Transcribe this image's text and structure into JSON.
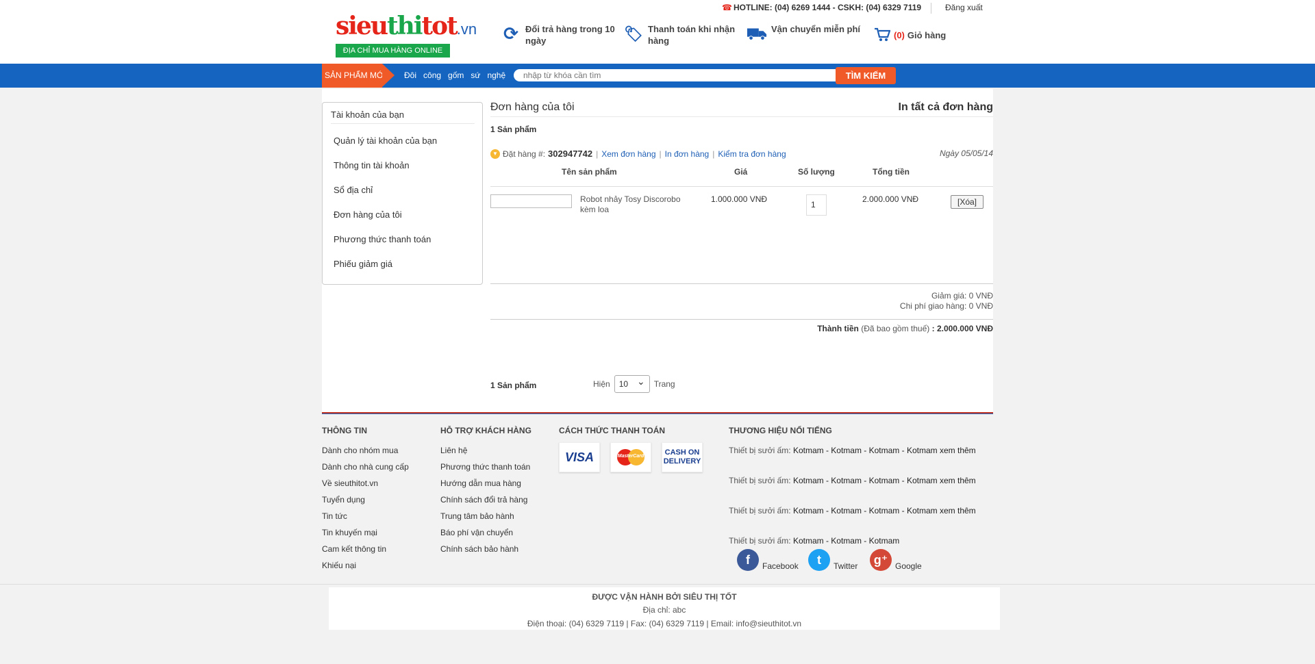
{
  "header": {
    "logo_main": "sieuthitot",
    "logo_part1": "sieu",
    "logo_part2": "thi",
    "logo_part3": "tot",
    "logo_domain": ".vn",
    "logo_tagline": "ĐỊA CHỈ MUA HÀNG ONLINE",
    "hotline": "HOTLINE: (04) 6269 1444 - CSKH: (04) 6329 7119",
    "logout": "Đăng xuất",
    "features": [
      {
        "icon": "refresh-icon",
        "label": "Đổi trả hàng trong 10 ngày"
      },
      {
        "icon": "price-tag-icon",
        "label": "Thanh toán khi nhận hàng"
      },
      {
        "icon": "truck-icon",
        "label": "Vận chuyển miễn phí"
      }
    ],
    "cart_count": "(0)",
    "cart_label": "Giỏ hàng"
  },
  "nav": {
    "new_products": "SẢN PHẨM MỚI",
    "links": [
      "Đôi",
      "công",
      "gốm",
      "sứ",
      "nghệ"
    ],
    "search_placeholder": "nhập từ khóa cần tìm",
    "search_button": "TÌM KIẾM"
  },
  "sidebar": {
    "title": "Tài khoản của bạn",
    "items": [
      "Quản lý tài khoản của bạn",
      "Thông tin tài khoản",
      "Sổ địa chỉ",
      "Đơn hàng của tôi",
      "Phương thức thanh toán",
      "Phiếu giảm giá"
    ]
  },
  "orders": {
    "title": "Đơn hàng của tôi",
    "print_all": "In tất cả đơn hàng",
    "count_label": "1 Sản phẩm",
    "order_label": "Đặt hàng #:",
    "order_number": "302947742",
    "view_order": "Xem đơn hàng",
    "print_order": "In đơn hàng",
    "check_order": "Kiểm tra đơn hàng",
    "order_date": "Ngày 05/05/14",
    "columns": {
      "name": "Tên sản phẩm",
      "price": "Giá",
      "quantity": "Số lượng",
      "total": "Tổng tiền"
    },
    "items": [
      {
        "name": "Robot nhảy Tosy Discorobo kèm loa",
        "price": "1.000.000 VNĐ",
        "quantity": "1",
        "total": "2.000.000 VNĐ",
        "delete": "[Xóa]"
      }
    ],
    "discount": "Giảm giá: 0 VNĐ",
    "shipping": "Chi phí giao hàng: 0 VNĐ",
    "grand_label": "Thành tiền",
    "grand_note": "(Đã bao gồm thuế)",
    "grand_value": ": 2.000.000 VNĐ",
    "pager_show": "Hiện",
    "pager_value": "10",
    "pager_page": "Trang"
  },
  "footer": {
    "col1_title": "THÔNG TIN",
    "col1_links": [
      "Dành cho nhóm mua",
      "Dành cho nhà cung cấp",
      "Về sieuthitot.vn",
      "Tuyển dụng",
      "Tin tức",
      "Tin khuyến mại",
      "Cam kết thông tin",
      "Khiếu nại"
    ],
    "col2_title": "HỖ TRỢ KHÁCH HÀNG",
    "col2_links": [
      "Liên hệ",
      "Phương thức thanh toán",
      "Hướng dẫn mua hàng",
      "Chính sách đổi trả hàng",
      "Trung tâm bảo hành",
      "Báo phí vận chuyển",
      "Chính sách bảo hành"
    ],
    "col3_title": "CÁCH THỨC THANH TOÁN",
    "pay_visa": "VISA",
    "pay_mc": "MasterCard",
    "pay_cod1": "CASH ON",
    "pay_cod2": "DELIVERY",
    "col4_title": "THƯƠNG HIỆU NỔI TIẾNG",
    "brand_label": "Thiết bị sưởi ấm:",
    "brand_rows": [
      "Kotmam - Kotmam - Kotmam - Kotmam xem thêm",
      "Kotmam - Kotmam - Kotmam - Kotmam xem thêm",
      "Kotmam - Kotmam - Kotmam - Kotmam xem thêm",
      "Kotmam - Kotmam - Kotmam"
    ],
    "social": [
      "Facebook",
      "Twitter",
      "Google"
    ],
    "operated": "ĐƯỢC VẬN HÀNH BỞI SIÊU THỊ TỐT",
    "address": "Địa chỉ: abc",
    "contact": "Điện thoại: (04) 6329 7119 | Fax: (04) 6329 7119 | Email: info@sieuthitot.vn"
  }
}
